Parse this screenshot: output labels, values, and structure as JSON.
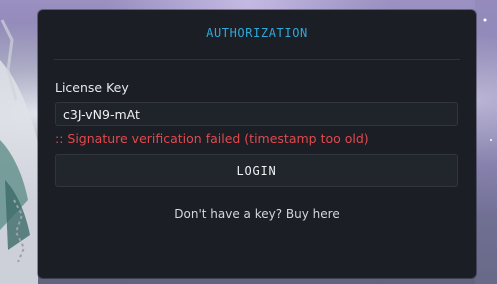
{
  "window": {
    "title": "AUTHORIZATION"
  },
  "form": {
    "license_label": "License Key",
    "license_value": "c3J-vN9-mAt",
    "error_message": ":: Signature verification failed (timestamp too old)",
    "login_label": "LOGIN",
    "buy_link_text": "Don't have a key? Buy here"
  },
  "colors": {
    "title_accent": "#2ea8d8",
    "error": "#e04a4f",
    "panel_bg": "#1b1e24"
  }
}
